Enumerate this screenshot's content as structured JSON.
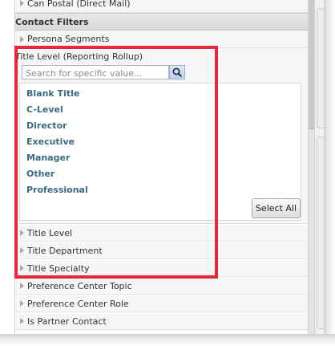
{
  "top_partial_item": {
    "label": "Can Postal (Direct Mail)"
  },
  "section": {
    "title": "Contact Filters"
  },
  "expanded_filter": {
    "label": "Title Level (Reporting Rollup)",
    "search_placeholder": "Search for specific value...",
    "values": [
      "Blank Title",
      "C-Level",
      "Director",
      "Executive",
      "Manager",
      "Other",
      "Professional"
    ],
    "select_all_label": "Select All"
  },
  "filters_before": [
    {
      "label": "Persona Segments"
    }
  ],
  "filters_after": [
    {
      "label": "Title Level"
    },
    {
      "label": "Title Department"
    },
    {
      "label": "Title Specialty"
    },
    {
      "label": "Preference Center Topic"
    },
    {
      "label": "Preference Center Role"
    },
    {
      "label": "Is Partner Contact"
    }
  ],
  "colors": {
    "value_link": "#3a6b80",
    "highlight_border": "#e8283c",
    "header_bg": "#dedede"
  },
  "icons": {
    "collapsed": "triangle-right-icon",
    "expanded": "triangle-down-icon",
    "search": "magnifier-icon"
  }
}
